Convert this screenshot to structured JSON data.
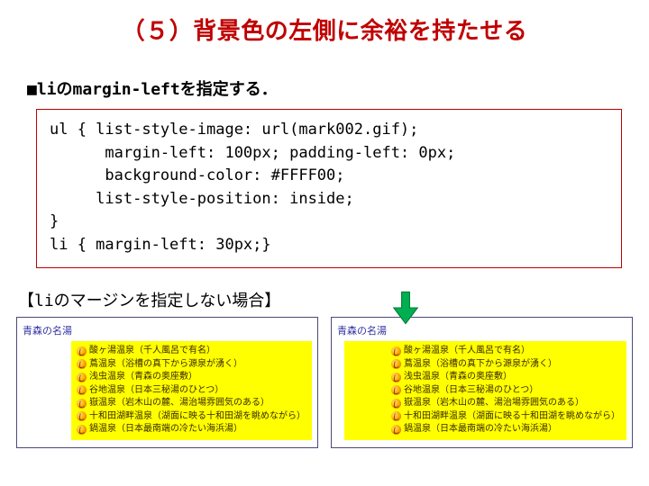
{
  "title": "（５）背景色の左側に余裕を持たせる",
  "subhead": "■liのmargin-leftを指定する．",
  "code": "ul { list-style-image: url(mark002.gif);\n      margin-left: 100px; padding-left: 0px;\n      background-color: #FFFF00;\n     list-style-position: inside;\n}\nli { margin-left: 30px;}",
  "caption": "【liのマージンを指定しない場合】",
  "example_heading": "青森の名湯",
  "items": [
    "酸ヶ湯温泉（千人風呂で有名）",
    "蔦温泉（浴槽の真下から源泉が湧く）",
    "浅虫温泉（青森の奥座敷）",
    "谷地温泉（日本三秘湯のひとつ）",
    "嶽温泉（岩木山の麓、湯治場雰囲気のある）",
    "十和田湖畔温泉（湖面に映る十和田湖を眺めながら）",
    "鍋温泉（日本最南端の冷たい海浜湯）"
  ]
}
